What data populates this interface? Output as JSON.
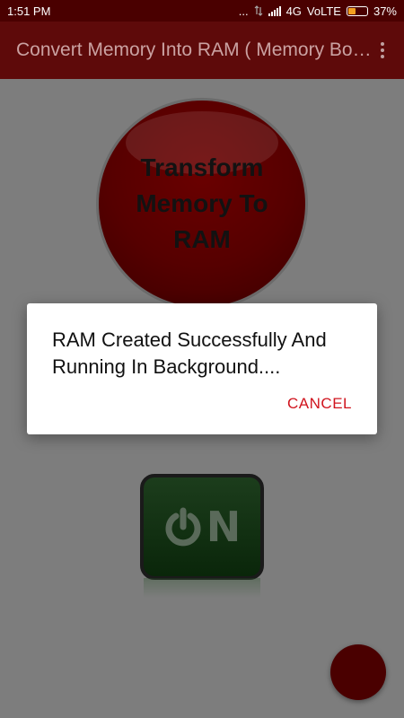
{
  "status_bar": {
    "time": "1:51 PM",
    "dots": "...",
    "network": "4G",
    "volte": "VoLTE",
    "battery_percent": "37%",
    "battery_level": 0.37
  },
  "app_bar": {
    "title": "Convert Memory Into RAM ( Memory Booster )",
    "overflow_icon": "more-vertical-icon"
  },
  "main": {
    "transform_button": {
      "label": "Transform Memory To RAM",
      "color": "#c40000"
    },
    "on_button": {
      "label_o": "power-icon",
      "label_n": "N",
      "color": "#1f9d1f"
    }
  },
  "fab": {
    "color": "#8b0000"
  },
  "dialog": {
    "message": "RAM Created Successfully And Running In Background....",
    "cancel_label": "CANCEL",
    "accent": "#d0141e"
  }
}
